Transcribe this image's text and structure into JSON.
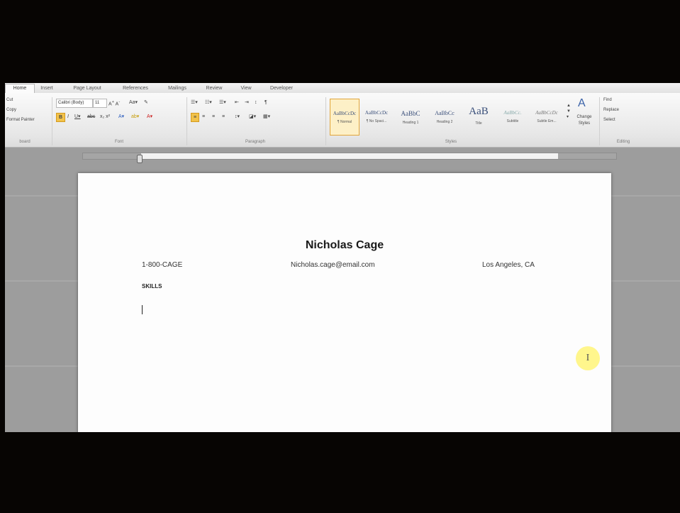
{
  "tabs": [
    "Home",
    "Insert",
    "Page Layout",
    "References",
    "Mailings",
    "Review",
    "View",
    "Developer"
  ],
  "clipboard": {
    "cut": "Cut",
    "copy": "Copy",
    "format_painter": "Format Painter",
    "label": "board"
  },
  "font": {
    "name": "Calibri (Body)",
    "size": "11",
    "label": "Font"
  },
  "paragraph": {
    "label": "Paragraph"
  },
  "styles": {
    "label": "Styles",
    "items": [
      {
        "sample": "AaBbCcDc",
        "name": "¶ Normal"
      },
      {
        "sample": "AaBbCcDc",
        "name": "¶ No Spaci..."
      },
      {
        "sample": "AaBbC",
        "name": "Heading 1"
      },
      {
        "sample": "AaBbCc",
        "name": "Heading 2"
      },
      {
        "sample": "AaB",
        "name": "Title"
      },
      {
        "sample": "AaBbCc.",
        "name": "Subtitle"
      },
      {
        "sample": "AaBbCcDc",
        "name": "Subtle Em..."
      }
    ],
    "change_styles": "Change Styles"
  },
  "editing": {
    "find": "Find",
    "replace": "Replace",
    "select": "Select",
    "label": "Editing"
  },
  "document": {
    "title": "Nicholas Cage",
    "phone": "1-800-CAGE",
    "email": "Nicholas.cage@email.com",
    "location": "Los Angeles, CA",
    "section": "SKILLS"
  },
  "cursor_glyph": "I"
}
